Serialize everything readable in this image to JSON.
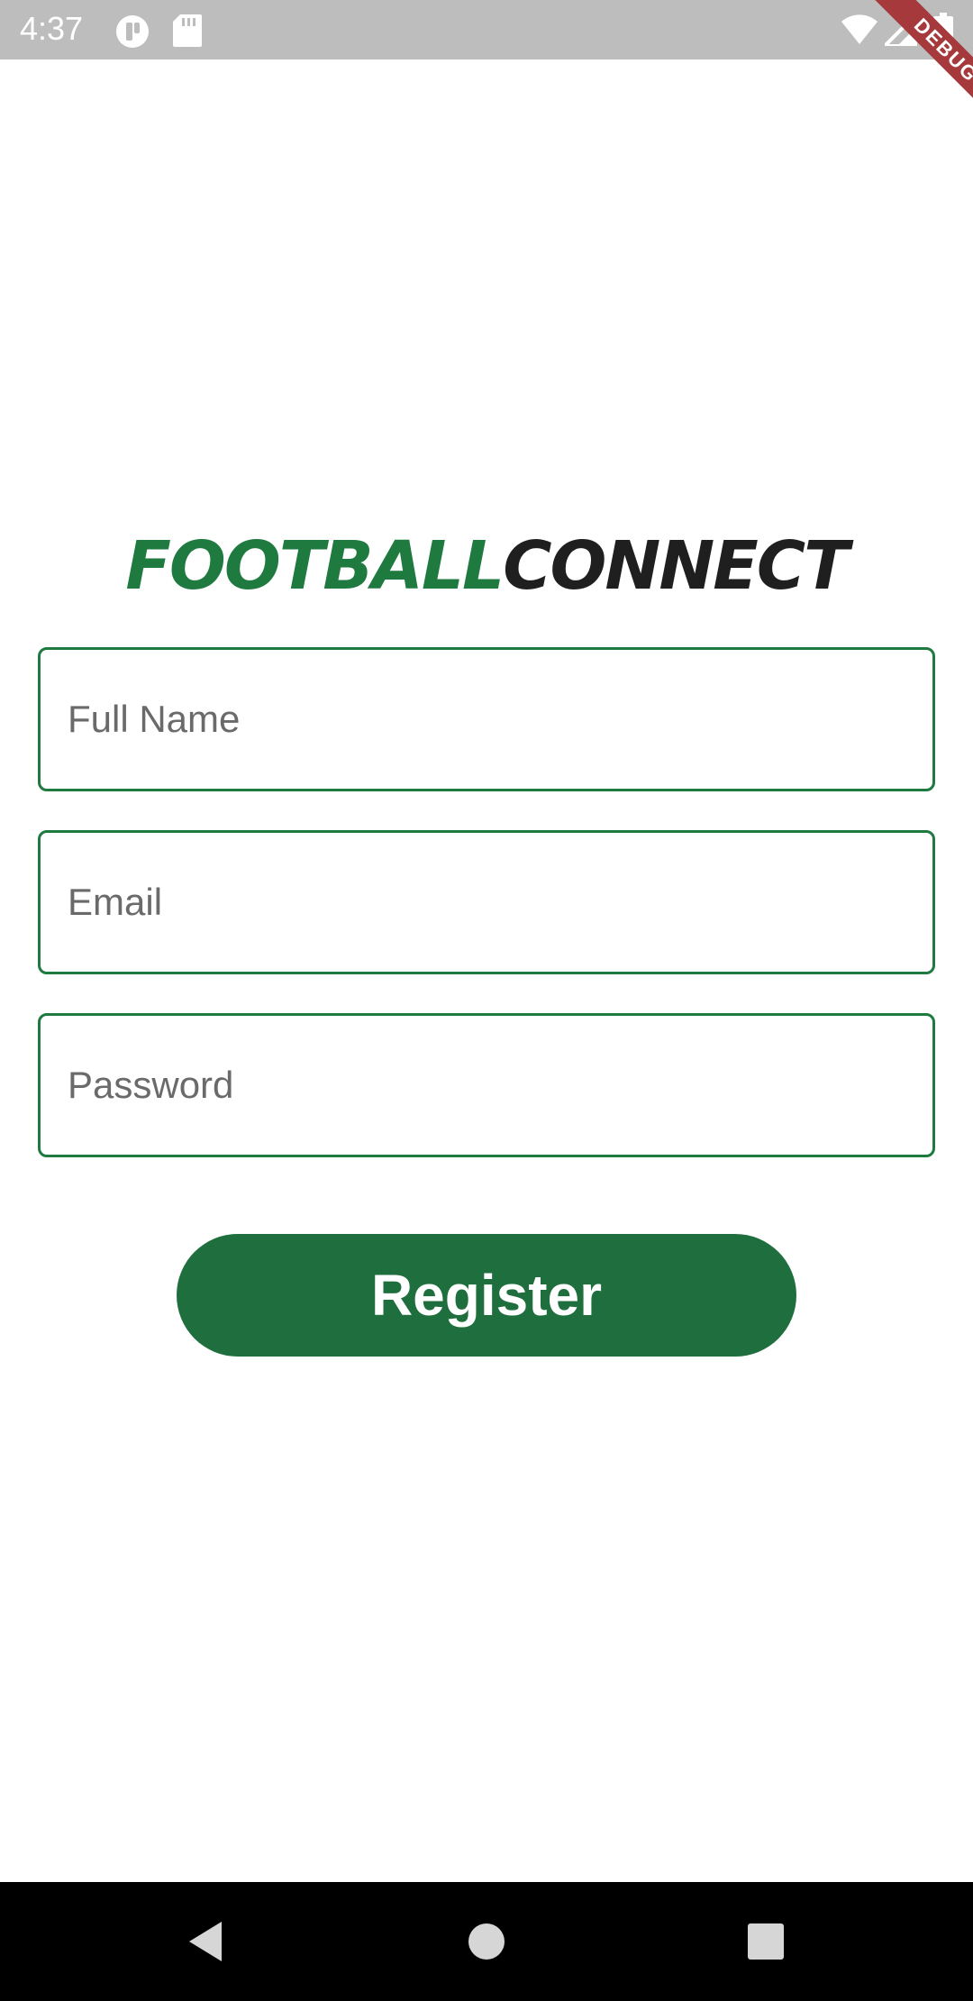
{
  "status_bar": {
    "time": "4:37",
    "icons": [
      "tunnel-icon",
      "sd-card-icon",
      "wifi-icon",
      "signal-icon",
      "battery-icon"
    ]
  },
  "debug_banner": {
    "label": "DEBUG",
    "color": "#a5393b"
  },
  "logo": {
    "part1": "FOOTBALL",
    "part2": "CONNECT",
    "color_part1": "#1e7a3f",
    "color_part2": "#1f1f1f"
  },
  "form": {
    "full_name": {
      "placeholder": "Full Name",
      "value": ""
    },
    "email": {
      "placeholder": "Email",
      "value": ""
    },
    "password": {
      "placeholder": "Password",
      "value": ""
    },
    "border_color": "#1e7a3f"
  },
  "register_button": {
    "label": "Register",
    "color": "#1e6f3d"
  },
  "nav_bar": {
    "buttons": [
      "back-icon",
      "home-icon",
      "recents-icon"
    ]
  }
}
